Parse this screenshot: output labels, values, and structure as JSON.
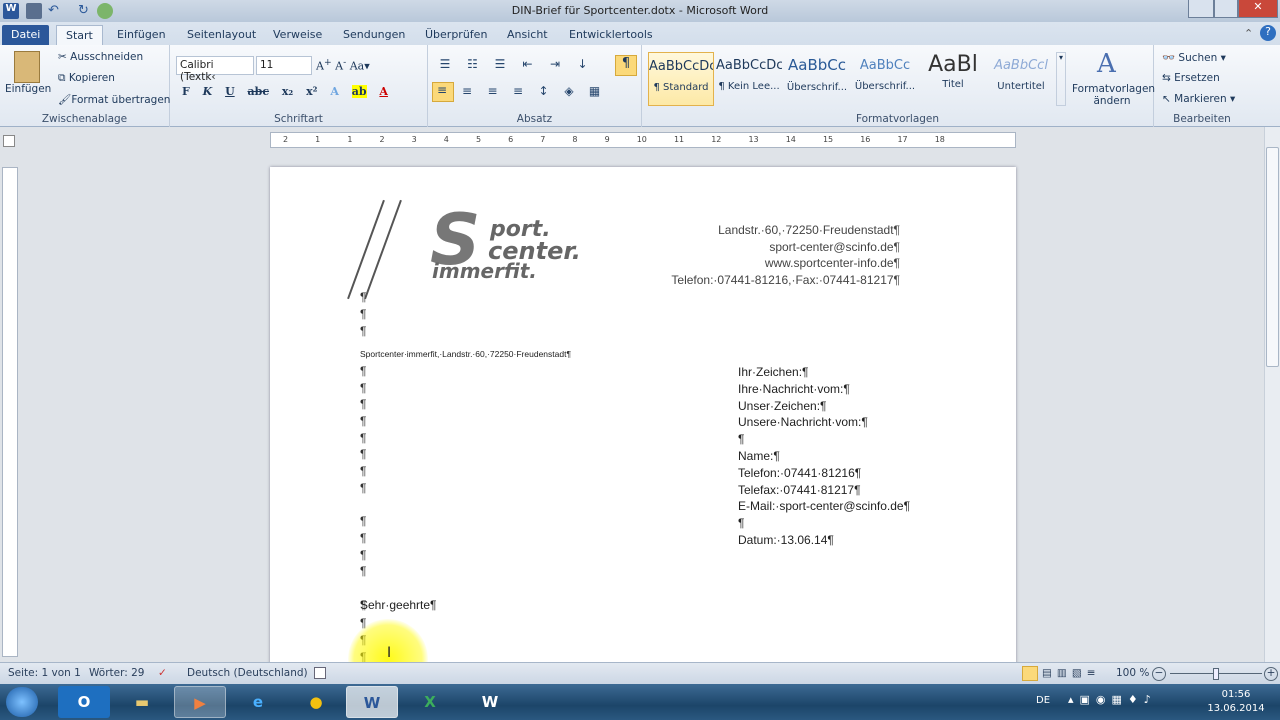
{
  "window": {
    "title": "DIN-Brief für Sportcenter.dotx - Microsoft Word"
  },
  "tabs": [
    "Datei",
    "Start",
    "Einfügen",
    "Seitenlayout",
    "Verweise",
    "Sendungen",
    "Überprüfen",
    "Ansicht",
    "Entwicklertools"
  ],
  "ribbon": {
    "clipboard": {
      "paste": "Einfügen",
      "cut": "Ausschneiden",
      "copy": "Kopieren",
      "format_painter": "Format übertragen",
      "label": "Zwischenablage"
    },
    "font": {
      "name": "Calibri (Textk‹",
      "size": "11",
      "label": "Schriftart",
      "bold": "F",
      "italic": "K",
      "underline": "U"
    },
    "paragraph": {
      "label": "Absatz",
      "show_marks": "¶"
    },
    "styles": {
      "items": [
        {
          "preview": "AaBbCcDc",
          "name": "¶ Standard"
        },
        {
          "preview": "AaBbCcDc",
          "name": "¶ Kein Lee..."
        },
        {
          "preview": "AaBbCc",
          "name": "Überschrif..."
        },
        {
          "preview": "AaBbCc",
          "name": "Überschrif..."
        },
        {
          "preview": "AaBl",
          "name": "Titel"
        },
        {
          "preview": "AaBbCcl",
          "name": "Untertitel"
        }
      ],
      "change": "Formatvorlagen ändern",
      "label": "Formatvorlagen"
    },
    "editing": {
      "find": "Suchen",
      "replace": "Ersetzen",
      "select": "Markieren",
      "label": "Bearbeiten"
    }
  },
  "ruler": [
    "2",
    "1",
    "1",
    "2",
    "3",
    "4",
    "5",
    "6",
    "7",
    "8",
    "9",
    "10",
    "11",
    "12",
    "13",
    "14",
    "15",
    "16",
    "17",
    "18"
  ],
  "document": {
    "logo": {
      "line1": "port.",
      "line2": "center.",
      "line3": "immerfit."
    },
    "header_lines": [
      "Landstr.·60,·72250·Freudenstadt¶",
      "sport-center@scinfo.de¶",
      "www.sportcenter-info.de¶",
      "Telefon:·07441-81216,·Fax:·07441-81217¶"
    ],
    "sender_line": "Sportcenter·immerfit,·Landstr.·60,·72250·Freudenstadt¶",
    "info_block": [
      "Ihr·Zeichen:¶",
      "Ihre·Nachricht·vom:¶",
      "Unser·Zeichen:¶",
      "Unsere·Nachricht·vom:¶",
      "¶",
      "Name:¶",
      "Telefon:·07441·81216¶",
      "Telefax:·07441·81217¶",
      "E-Mail:·sport-center@scinfo.de¶",
      "¶",
      "Datum:·13.06.14¶"
    ],
    "pilcrow": "¶",
    "salutation": "Sehr·geehrte¶"
  },
  "status": {
    "page": "Seite: 1 von 1",
    "words": "Wörter: 29",
    "language": "Deutsch (Deutschland)",
    "zoom": "100 %",
    "zoom_percent": 100
  },
  "taskbar": {
    "items": [
      "Outlook",
      "Explorer",
      "Media",
      "Internet Explorer",
      "Chrome",
      "Word",
      "Excel",
      "Word"
    ],
    "lang": "DE",
    "time": "01:56",
    "date": "13.06.2014"
  }
}
